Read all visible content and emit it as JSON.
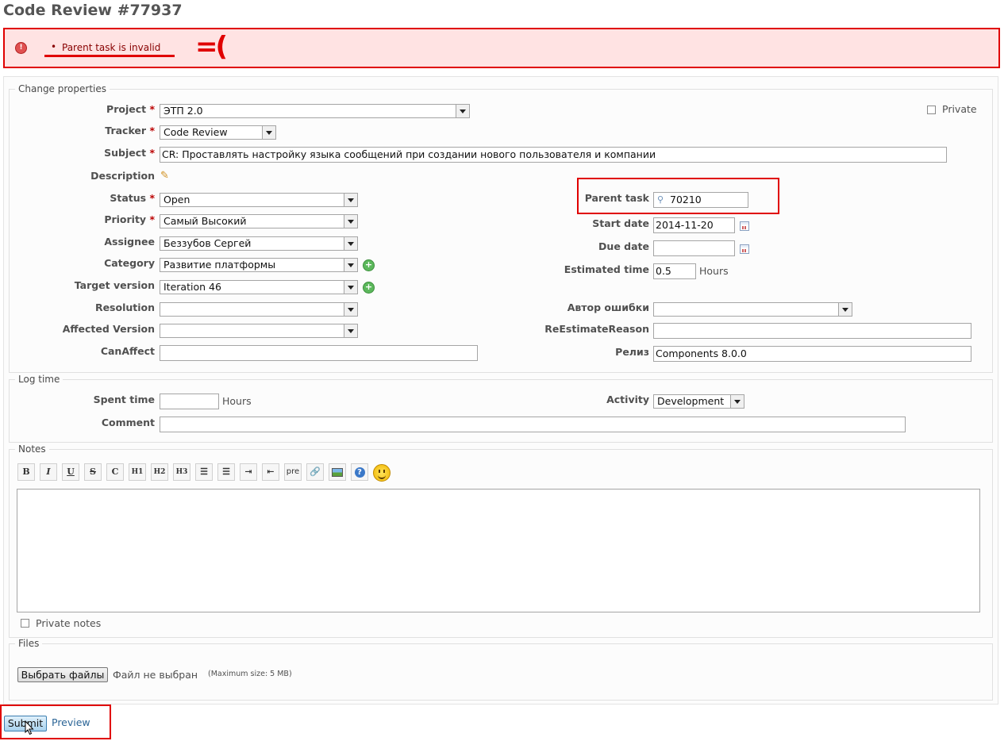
{
  "page": {
    "title": "Code Review #77937"
  },
  "error": {
    "message": "Parent task is invalid",
    "annotation": "=("
  },
  "properties": {
    "legend": "Change properties",
    "private_label": "Private",
    "project": {
      "label": "Project",
      "value": "ЭТП 2.0"
    },
    "tracker": {
      "label": "Tracker",
      "value": "Code Review"
    },
    "subject": {
      "label": "Subject",
      "value": "CR: Проставлять настройку языка сообщений при создании нового пользователя и компании"
    },
    "description": {
      "label": "Description"
    },
    "status": {
      "label": "Status",
      "value": "Open"
    },
    "priority": {
      "label": "Priority",
      "value": "Самый Высокий"
    },
    "assignee": {
      "label": "Assignee",
      "value": "Беззубов Сергей"
    },
    "category": {
      "label": "Category",
      "value": "Развитие платформы"
    },
    "target_version": {
      "label": "Target version",
      "value": "Iteration 46"
    },
    "resolution": {
      "label": "Resolution",
      "value": ""
    },
    "affected_version": {
      "label": "Affected Version",
      "value": ""
    },
    "can_affect": {
      "label": "CanAffect",
      "value": ""
    },
    "parent_task": {
      "label": "Parent task",
      "value": "70210"
    },
    "start_date": {
      "label": "Start date",
      "value": "2014-11-20"
    },
    "due_date": {
      "label": "Due date",
      "value": ""
    },
    "estimated_time": {
      "label": "Estimated time",
      "value": "0.5",
      "unit": "Hours"
    },
    "error_author": {
      "label": "Автор ошибки",
      "value": ""
    },
    "reestimate_reason": {
      "label": "ReEstimateReason",
      "value": ""
    },
    "release": {
      "label": "Релиз",
      "value": "Components 8.0.0"
    }
  },
  "log_time": {
    "legend": "Log time",
    "spent_time": {
      "label": "Spent time",
      "value": "",
      "unit": "Hours"
    },
    "activity": {
      "label": "Activity",
      "value": "Development"
    },
    "comment": {
      "label": "Comment",
      "value": ""
    }
  },
  "notes": {
    "legend": "Notes",
    "toolbar": [
      "B",
      "I",
      "U",
      "S",
      "C",
      "H1",
      "H2",
      "H3",
      "ul",
      "ol",
      "indent-right",
      "indent-left",
      "pre",
      "link",
      "image",
      "help",
      "smiley"
    ],
    "private_notes_label": "Private notes"
  },
  "files": {
    "legend": "Files",
    "choose_button": "Выбрать файлы",
    "no_file_text": "Файл не выбран",
    "max_size": "(Maximum size: 5 MB)"
  },
  "actions": {
    "submit": "Submit",
    "preview": "Preview"
  },
  "colors": {
    "error_border": "#e00000",
    "error_bg": "#ffe3e3",
    "link": "#2a6496",
    "required": "#bb0000"
  }
}
